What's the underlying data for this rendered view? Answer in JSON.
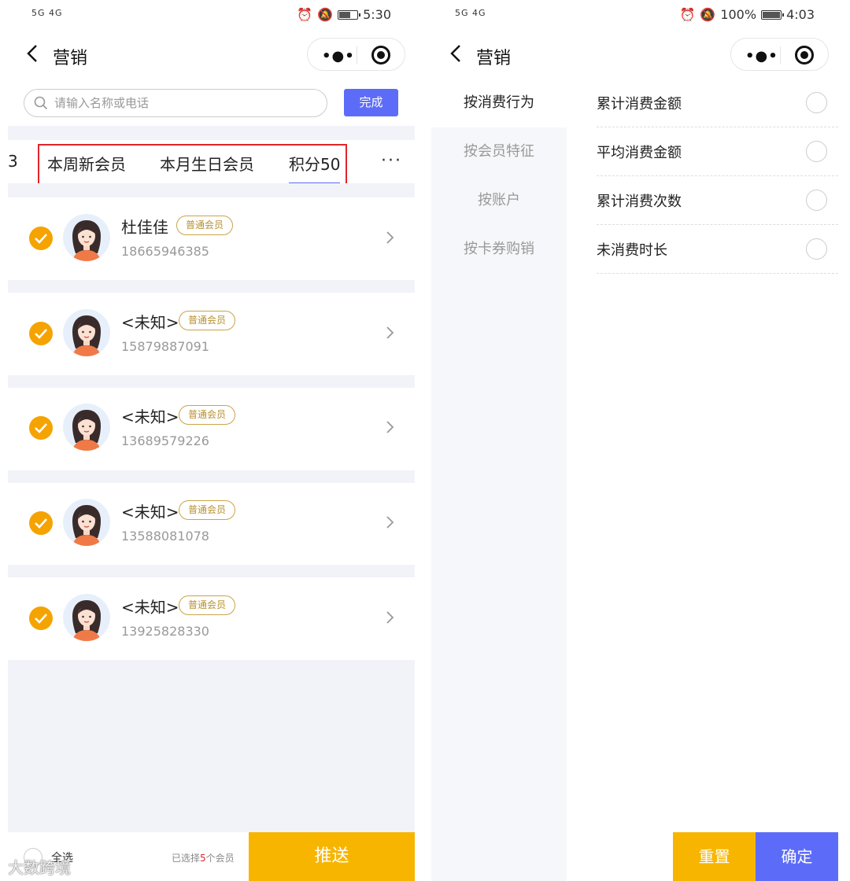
{
  "left": {
    "status": {
      "signal": "5G 4G",
      "time": "5:30"
    },
    "nav": {
      "title": "营销"
    },
    "search": {
      "placeholder": "请输入名称或电话",
      "done_label": "完成"
    },
    "tabs": {
      "fragment": "3",
      "items": [
        "本周新会员",
        "本月生日会员",
        "积分50"
      ],
      "active_index": 2,
      "more": "···"
    },
    "members": [
      {
        "name": "杜佳佳",
        "badge": "普通会员",
        "phone": "18665946385",
        "checked": true
      },
      {
        "name": "<未知>",
        "badge": "普通会员",
        "phone": "15879887091",
        "checked": true
      },
      {
        "name": "<未知>",
        "badge": "普通会员",
        "phone": "13689579226",
        "checked": true
      },
      {
        "name": "<未知>",
        "badge": "普通会员",
        "phone": "13588081078",
        "checked": true
      },
      {
        "name": "<未知>",
        "badge": "普通会员",
        "phone": "13925828330",
        "checked": true
      }
    ],
    "bottom": {
      "select_all": "全选",
      "selected_prefix": "已选择",
      "selected_count": "5",
      "selected_suffix": "个会员",
      "push_label": "推送"
    },
    "watermark": "大数跨境"
  },
  "right": {
    "status": {
      "signal": "5G 4G",
      "battery": "100%",
      "time": "4:03"
    },
    "nav": {
      "title": "营销"
    },
    "categories": [
      "按消费行为",
      "按会员特征",
      "按账户",
      "按卡券购销"
    ],
    "active_category": 0,
    "options": [
      "累计消费金额",
      "平均消费金额",
      "累计消费次数",
      "未消费时长"
    ],
    "buttons": {
      "reset": "重置",
      "confirm": "确定"
    }
  },
  "colors": {
    "accent_blue": "#5d6cf8",
    "accent_orange": "#f7b500",
    "check_orange": "#f5a300",
    "badge_gold": "#c9a44a",
    "highlight_red": "#e0252a"
  }
}
